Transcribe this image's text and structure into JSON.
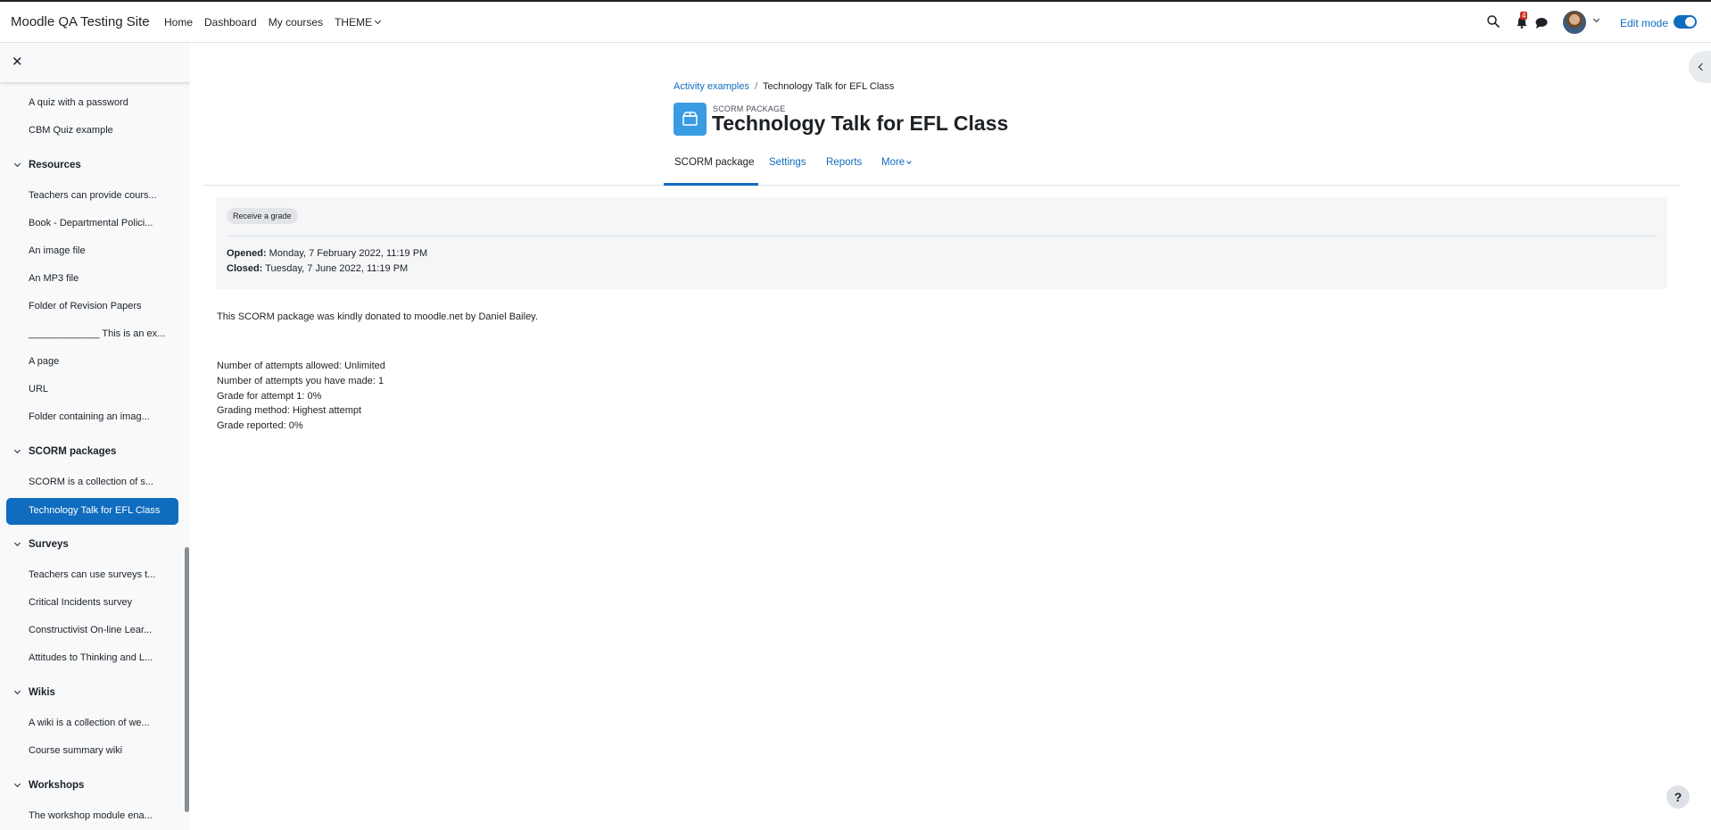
{
  "header": {
    "site_name": "Moodle QA Testing Site",
    "nav": [
      "Home",
      "Dashboard",
      "My courses",
      "THEME"
    ],
    "notification_count": "4",
    "edit_mode_label": "Edit mode",
    "edit_mode_on": true
  },
  "drawer": {
    "items_top": [
      "A quiz with a password",
      "CBM Quiz example"
    ],
    "sections": [
      {
        "title": "Resources",
        "items": [
          "Teachers can provide cours...",
          "Book - Departmental Polici...",
          "An image file",
          "An MP3 file",
          "Folder of Revision Papers",
          "_____________ This is an ex...",
          "A page",
          "URL",
          "Folder containing an imag..."
        ]
      },
      {
        "title": "SCORM packages",
        "items": [
          "SCORM is a collection of s...",
          "Technology Talk for EFL Class"
        ]
      },
      {
        "title": "Surveys",
        "items": [
          "Teachers can use surveys t...",
          "Critical Incidents survey",
          "Constructivist On-line Lear...",
          "Attitudes to Thinking and L..."
        ]
      },
      {
        "title": "Wikis",
        "items": [
          "A wiki is a collection of we...",
          "Course summary wiki"
        ]
      },
      {
        "title": "Workshops",
        "items": [
          "The workshop module ena..."
        ]
      }
    ],
    "active_item": "Technology Talk for EFL Class"
  },
  "breadcrumb": {
    "parent": "Activity examples",
    "current": "Technology Talk for EFL Class"
  },
  "activity": {
    "type_label": "SCORM PACKAGE",
    "title": "Technology Talk for EFL Class"
  },
  "tabs": [
    "SCORM package",
    "Settings",
    "Reports",
    "More"
  ],
  "completion": {
    "condition": "Receive a grade",
    "opened_label": "Opened:",
    "opened_value": " Monday, 7 February 2022, 11:19 PM",
    "closed_label": "Closed:",
    "closed_value": " Tuesday, 7 June 2022, 11:19 PM"
  },
  "description": "This SCORM package was kindly donated to moodle.net by Daniel Bailey.",
  "attempts": [
    "Number of attempts allowed: Unlimited",
    "Number of attempts you have made: 1",
    "Grade for attempt 1: 0%",
    "Grading method: Highest attempt",
    "Grade reported: 0%"
  ],
  "help_label": "?",
  "colors": {
    "primary": "#0f6cbf",
    "module_icon": "#399be2",
    "notification": "#ca3120"
  }
}
